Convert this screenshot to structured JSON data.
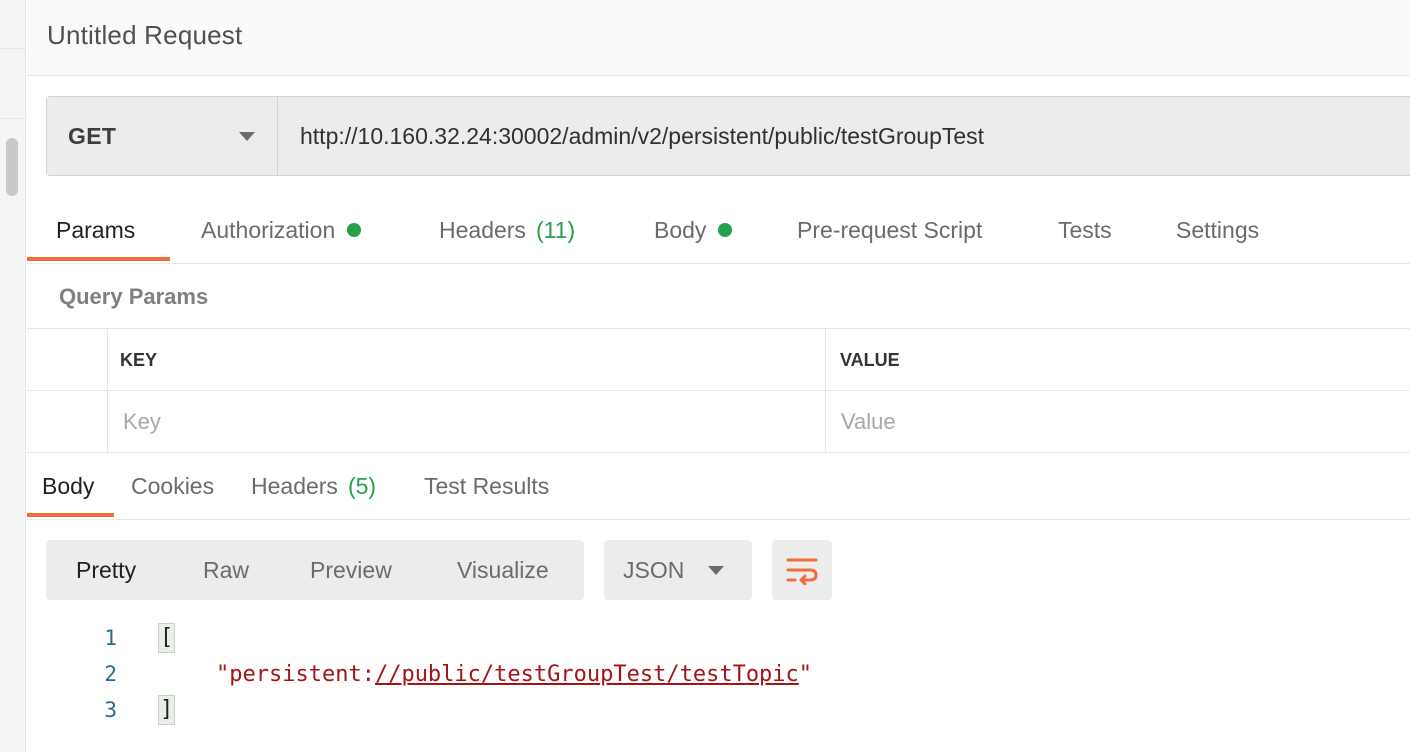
{
  "app": {
    "title": "Untitled Request"
  },
  "request": {
    "method": "GET",
    "url": "http://10.160.32.24:30002/admin/v2/persistent/public/testGroupTest"
  },
  "request_tabs": [
    {
      "label": "Params",
      "active": true
    },
    {
      "label": "Authorization",
      "dot": true
    },
    {
      "label": "Headers",
      "count": "(11)"
    },
    {
      "label": "Body",
      "dot": true
    },
    {
      "label": "Pre-request Script"
    },
    {
      "label": "Tests"
    },
    {
      "label": "Settings"
    }
  ],
  "query_params": {
    "title": "Query Params",
    "columns": [
      "KEY",
      "VALUE"
    ],
    "placeholder_row": [
      "Key",
      "Value"
    ]
  },
  "response_tabs": [
    {
      "label": "Body",
      "active": true
    },
    {
      "label": "Cookies"
    },
    {
      "label": "Headers",
      "count": "(5)"
    },
    {
      "label": "Test Results"
    }
  ],
  "response_toolbar": {
    "formats": [
      "Pretty",
      "Raw",
      "Preview",
      "Visualize"
    ],
    "active_format": "Pretty",
    "language": "JSON"
  },
  "response_body": {
    "line_numbers": [
      "1",
      "2",
      "3"
    ],
    "open_bracket": "[",
    "string_prefix": "\"persistent:",
    "string_link": "//public/testGroupTest/testTopic",
    "string_suffix": "\"",
    "close_bracket": "]"
  },
  "colors": {
    "accent": "#f26b3a",
    "success": "#26a04c",
    "string": "#a31515",
    "line_number": "#2e6b8a"
  }
}
